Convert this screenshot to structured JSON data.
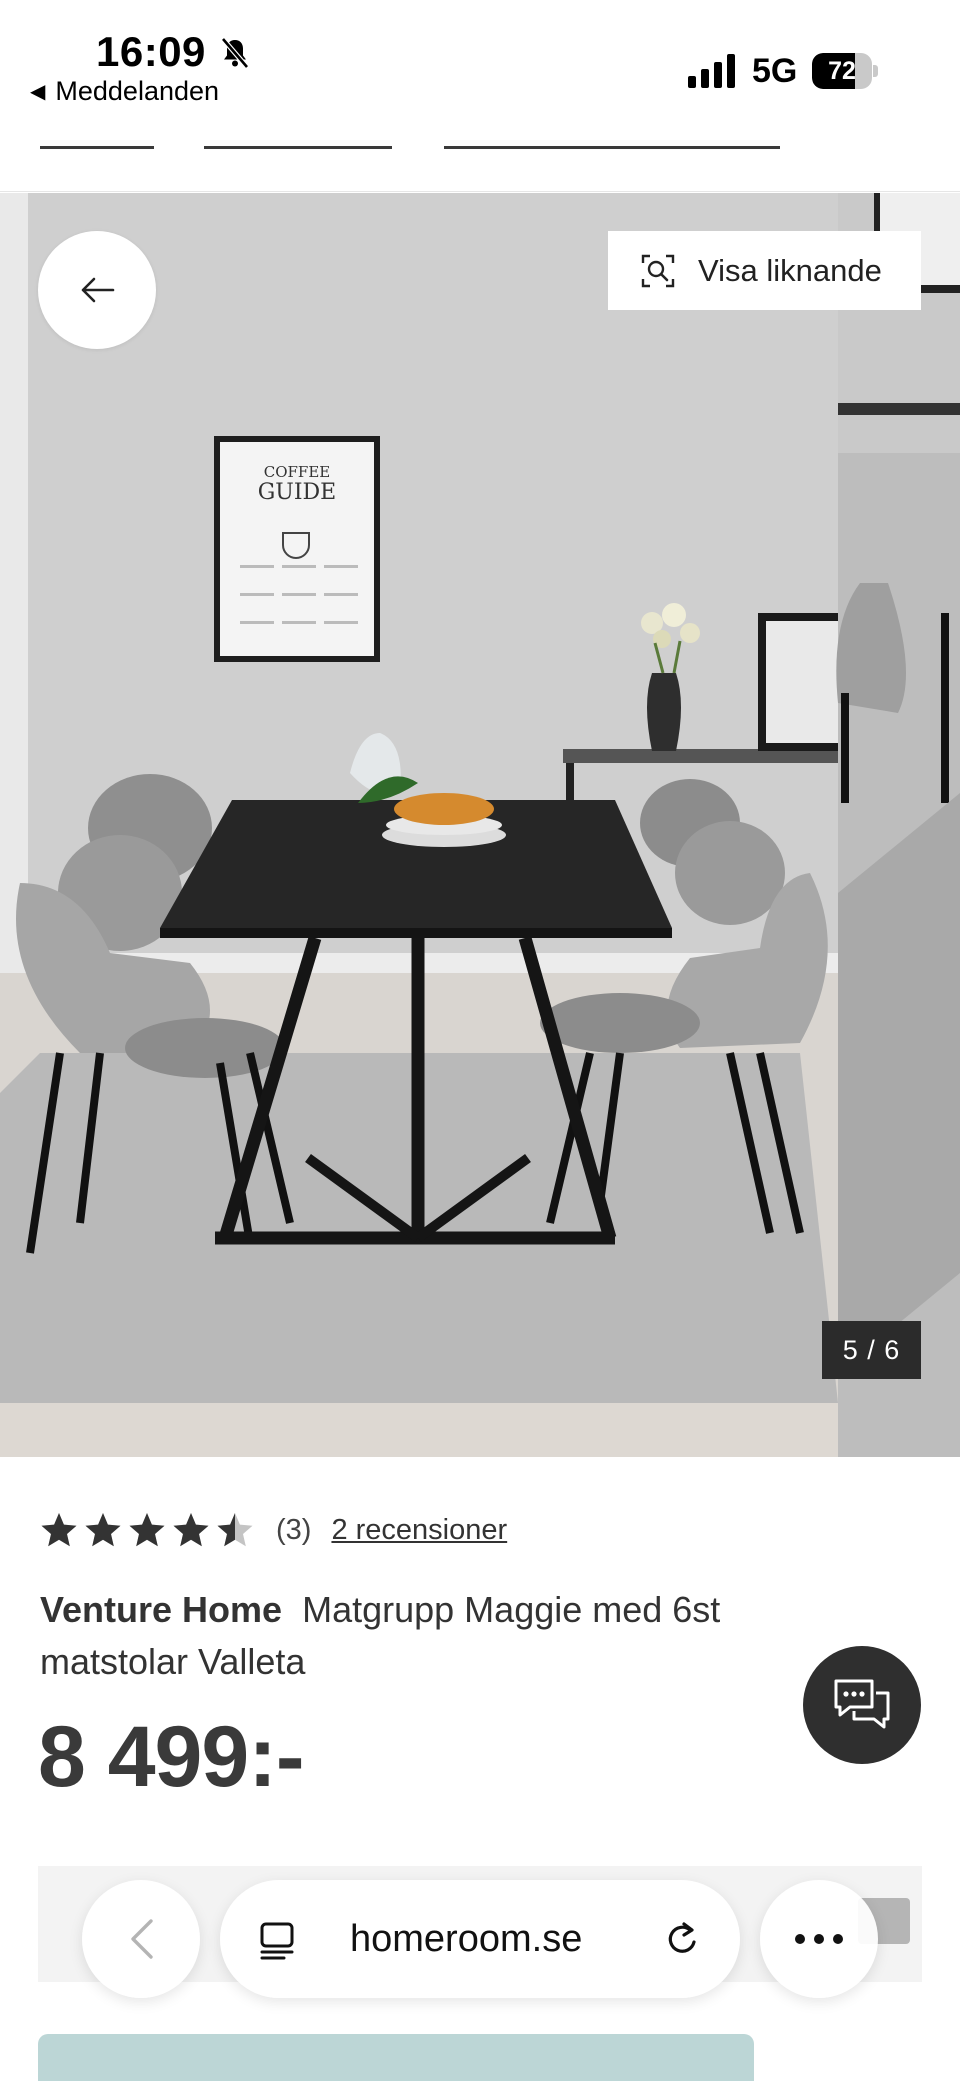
{
  "status_bar": {
    "time": "16:09",
    "back_app": "Meddelanden",
    "network": "5G",
    "battery_percent": "72",
    "battery_level": 0.72
  },
  "gallery": {
    "similar_button_label": "Visa liknande",
    "counter": "5 / 6",
    "current_image": 5,
    "total_images": 6,
    "poster_title_line1": "COFFEE",
    "poster_title_line2": "GUIDE"
  },
  "product": {
    "rating_value": 4.5,
    "rating_max": 5,
    "rating_count": "(3)",
    "reviews_link": "2 recensioner",
    "brand": "Venture Home",
    "name": "Matgrupp Maggie med 6st matstolar Valleta",
    "price": "8 499:-"
  },
  "browser": {
    "address": "homeroom.se"
  },
  "icons": {
    "back": "arrow-left-icon",
    "similar": "visual-search-icon",
    "chat": "chat-bubbles-icon",
    "bell": "bell-slash-icon",
    "tabs": "tabs-icon",
    "reload": "reload-icon",
    "more": "more-dots-icon"
  },
  "colors": {
    "text": "#333333",
    "chat_bg": "#2f2f2f",
    "counter_bg": "#2b2b2b",
    "teal": "#bcd6d6"
  }
}
